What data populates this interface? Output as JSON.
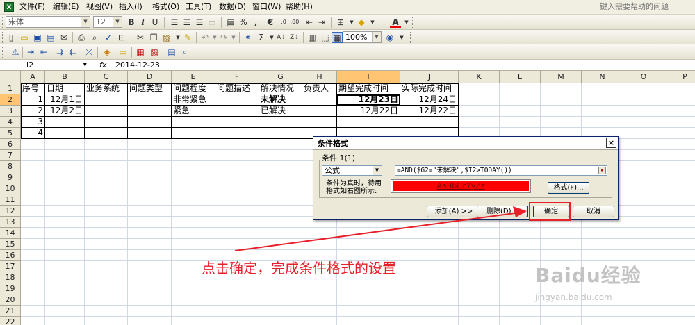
{
  "menubar": {
    "items": [
      "文件(F)",
      "编辑(E)",
      "视图(V)",
      "插入(I)",
      "格式(O)",
      "工具(T)",
      "数据(D)",
      "窗口(W)",
      "帮助(H)"
    ],
    "help_search_placeholder": "键入需要帮助的问题"
  },
  "toolbar1": {
    "font_name": "宋体",
    "font_size": "12",
    "bold": "B",
    "italic": "I",
    "underline": "U",
    "percent": "%",
    "comma": ",",
    "euro": "€",
    "font_color_letter": "A"
  },
  "toolbar2": {
    "zoom": "100%",
    "sigma": "Σ"
  },
  "formula_bar": {
    "name_box": "I2",
    "fx": "fx",
    "value": "2014-12-23"
  },
  "sheet": {
    "columns": [
      "A",
      "B",
      "C",
      "D",
      "E",
      "F",
      "G",
      "H",
      "I",
      "J",
      "K",
      "L",
      "M",
      "N",
      "O",
      "P"
    ],
    "rows": [
      "1",
      "2",
      "3",
      "4",
      "5",
      "6",
      "7",
      "8",
      "9",
      "10",
      "11",
      "12",
      "13",
      "14",
      "15",
      "16",
      "17",
      "18",
      "19",
      "20",
      "21",
      "22"
    ],
    "table": [
      [
        "序号",
        "日期",
        "业务系统",
        "问题类型",
        "问题程度",
        "问题描述",
        "解决情况",
        "负责人",
        "期望完成时间",
        "实际完成时间"
      ],
      [
        "1",
        "12月1日",
        "",
        "",
        "非常紧急",
        "",
        "未解决",
        "",
        "12月23日",
        "12月24日"
      ],
      [
        "2",
        "12月2日",
        "",
        "",
        "紧急",
        "",
        "已解决",
        "",
        "12月22日",
        "12月22日"
      ],
      [
        "3",
        "",
        "",
        "",
        "",
        "",
        "",
        "",
        "",
        ""
      ],
      [
        "4",
        "",
        "",
        "",
        "",
        "",
        "",
        "",
        "",
        ""
      ]
    ]
  },
  "dialog": {
    "title": "条件格式",
    "close": "×",
    "condition_label": "条件 1(1)",
    "condition_type": "公式",
    "formula": "=AND($G2=\"未解决\",$I2>TODAY())",
    "hint": "条件为真时，待用格式如右图所示:",
    "preview_text": "AaBbCcYyZz",
    "preview_color": "#ff0000",
    "format_button": "格式(F)...",
    "add_button": "添加(A) >>",
    "delete_button": "删除(D)...",
    "ok_button": "确定",
    "cancel_button": "取消"
  },
  "annotation": {
    "text": "点击确定，完成条件格式的设置",
    "color": "#e8202a"
  },
  "watermark": {
    "main": "Baidu经验",
    "sub": "jingyan.baidu.com"
  }
}
